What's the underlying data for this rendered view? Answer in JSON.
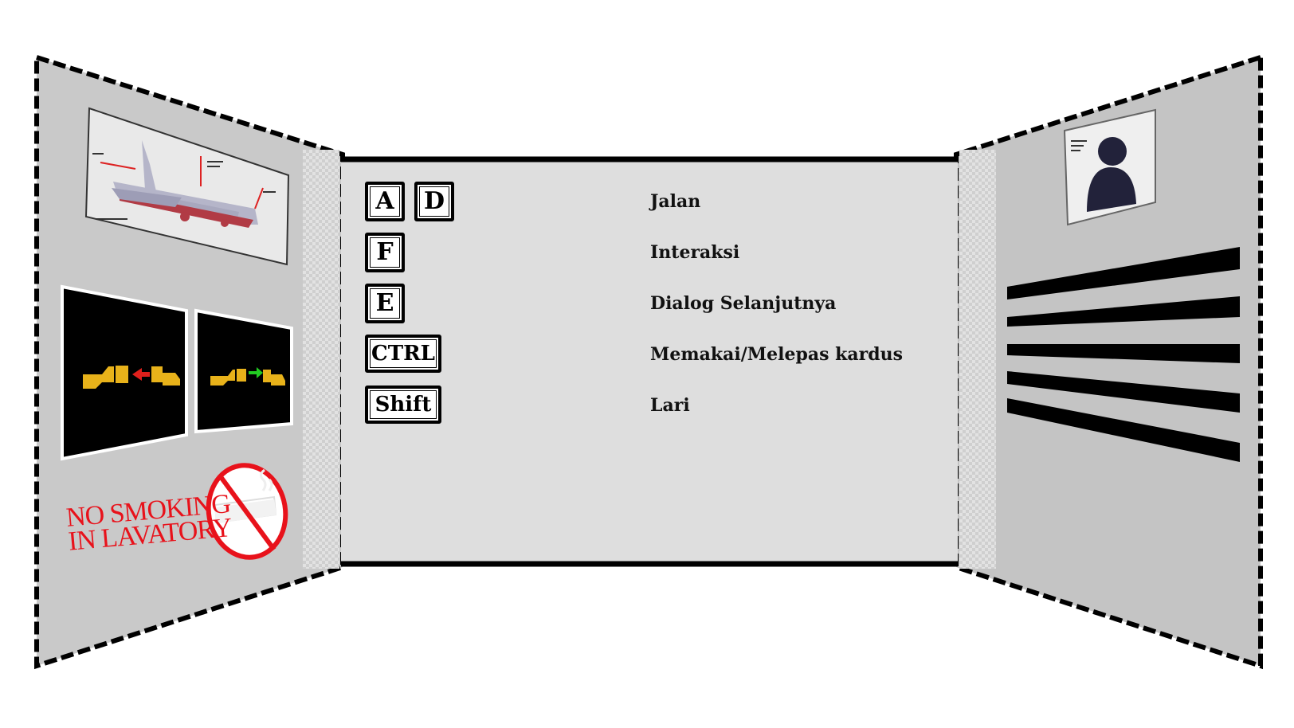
{
  "controls": [
    {
      "keys": [
        "A",
        "D"
      ],
      "action": "Jalan"
    },
    {
      "keys": [
        "F"
      ],
      "action": "Interaksi"
    },
    {
      "keys": [
        "E"
      ],
      "action": "Dialog Selanjutnya"
    },
    {
      "keys": [
        "CTRL"
      ],
      "action": "Memakai/Melepas kardus"
    },
    {
      "keys": [
        "Shift"
      ],
      "action": "Lari"
    }
  ],
  "signs": {
    "no_smoking_line1": "NO SMOKING",
    "no_smoking_line2": "IN LAVATORY"
  },
  "icons": {
    "airplane_diagram": "airplane-diagram-icon",
    "seatbelt_fasten": "seatbelt-fasten-icon",
    "seatbelt_unfasten": "seatbelt-unfasten-icon",
    "no_smoking": "no-smoking-icon",
    "profile_card": "person-silhouette-icon"
  },
  "colors": {
    "wall_side": "#c9c9c9",
    "wall_center": "#dedede",
    "outline": "#000000",
    "sign_red": "#e8121b",
    "seatbelt_gold": "#e8b21a",
    "arrow_red": "#e0201c",
    "arrow_green": "#22cc22",
    "silhouette": "#22223a"
  }
}
